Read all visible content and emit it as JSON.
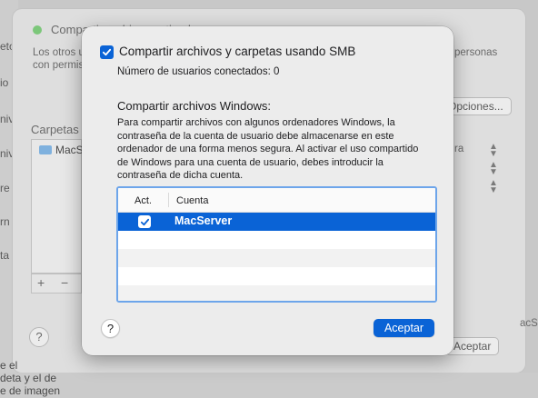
{
  "background": {
    "window_title": "Compartir archivos activado",
    "left_fragments": [
      "eto",
      "io",
      "D c",
      "niv",
      "niv",
      "re",
      "rn",
      "ta"
    ],
    "desc_line1": "Los otros u",
    "desc_line1_right": "personas",
    "desc_line2": "con permis",
    "options_button": "Opciones...",
    "folders_label": "Carpetas",
    "folder_item": "MacS",
    "users_fragment": "ra",
    "right_fragment": "acS",
    "plus": "+",
    "minus": "−",
    "help": "?",
    "accept_button": "Aceptar",
    "bottom_lines": [
      "e el",
      "deta y el de",
      "e de imagen"
    ]
  },
  "sheet": {
    "smb_checkbox_label": "Compartir archivos y carpetas usando SMB",
    "smb_checked": true,
    "connected_users": "Número de usuarios conectados: 0",
    "windows_heading": "Compartir archivos Windows:",
    "windows_description": "Para compartir archivos con algunos ordenadores Windows, la contraseña de la cuenta de usuario debe almacenarse en este ordenador de una forma menos segura. Al activar el uso compartido de Windows para una cuenta de usuario, debes introducir la contraseña de dicha cuenta.",
    "table": {
      "col_active": "Act.",
      "col_account": "Cuenta",
      "rows": [
        {
          "active": true,
          "account": "MacServer"
        }
      ]
    },
    "help_label": "?",
    "accept_label": "Aceptar"
  },
  "colors": {
    "accent": "#0a63d6",
    "sheet_bg": "#ececec",
    "focus_ring": "#6da5ea"
  }
}
